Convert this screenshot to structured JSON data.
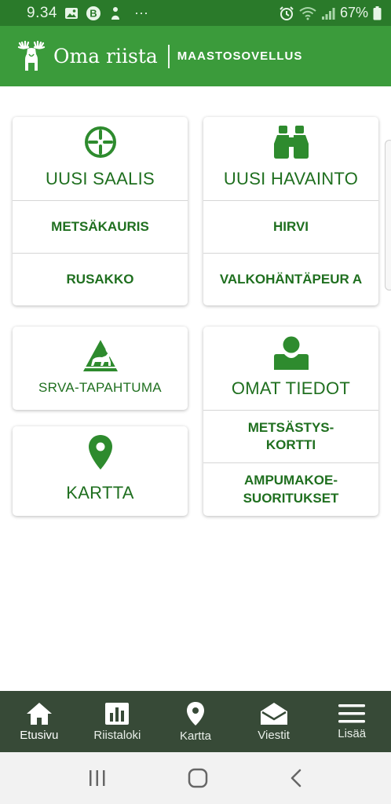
{
  "status_bar": {
    "time": "9.34",
    "battery": "67%",
    "dots": "···"
  },
  "header": {
    "title": "Oma riista",
    "subtitle": "MAASTOSOVELLUS"
  },
  "cards": {
    "catch": {
      "title": "UUSI SAALIS",
      "items": [
        "METSÄKAURIS",
        "RUSAKKO"
      ]
    },
    "observation": {
      "title": "UUSI HAVAINTO",
      "items": [
        "HIRVI",
        "VALKOHÄNTÄPEUR A"
      ]
    },
    "srva": {
      "title": "SRVA-TAPAHTUMA"
    },
    "map": {
      "title": "KARTTA"
    },
    "my_info": {
      "title": "OMAT TIEDOT",
      "items": [
        "METSÄSTYS-\nKORTTI",
        "AMPUMAKOE-\nSUORITUKSET"
      ]
    }
  },
  "bottom_nav": {
    "items": [
      {
        "label": "Etusivu",
        "icon": "home-icon"
      },
      {
        "label": "Riistaloki",
        "icon": "bar-chart-icon"
      },
      {
        "label": "Kartta",
        "icon": "map-pin-icon"
      },
      {
        "label": "Viestit",
        "icon": "envelope-open-icon"
      },
      {
        "label": "Lisää",
        "icon": "hamburger-menu-icon"
      }
    ]
  },
  "colors": {
    "status_bar": "#2a7a2a",
    "header": "#3b9b3b",
    "accent": "#2e8b2e",
    "text_green": "#1f6f1f",
    "bottom_nav": "#374a37"
  }
}
